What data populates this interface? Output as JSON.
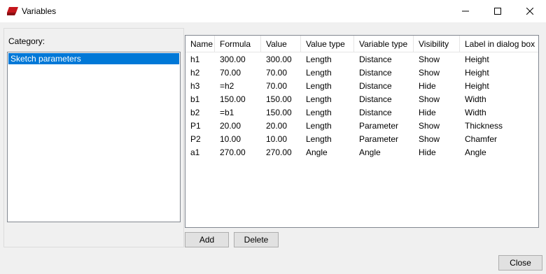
{
  "window": {
    "title": "Variables"
  },
  "category": {
    "label": "Category:",
    "items": [
      "Sketch parameters"
    ]
  },
  "table": {
    "columns": [
      "Name",
      "Formula",
      "Value",
      "Value type",
      "Variable type",
      "Visibility",
      "Label in dialog box"
    ],
    "rows": [
      [
        "h1",
        "300.00",
        "300.00",
        "Length",
        "Distance",
        "Show",
        "Height"
      ],
      [
        "h2",
        "70.00",
        "70.00",
        "Length",
        "Distance",
        "Show",
        "Height"
      ],
      [
        "h3",
        "=h2",
        "70.00",
        "Length",
        "Distance",
        "Hide",
        "Height"
      ],
      [
        "b1",
        "150.00",
        "150.00",
        "Length",
        "Distance",
        "Show",
        "Width"
      ],
      [
        "b2",
        "=b1",
        "150.00",
        "Length",
        "Distance",
        "Hide",
        "Width"
      ],
      [
        "P1",
        "20.00",
        "20.00",
        "Length",
        "Parameter",
        "Show",
        "Thickness"
      ],
      [
        "P2",
        "10.00",
        "10.00",
        "Length",
        "Parameter",
        "Show",
        "Chamfer"
      ],
      [
        "a1",
        "270.00",
        "270.00",
        "Angle",
        "Angle",
        "Hide",
        "Angle"
      ]
    ]
  },
  "buttons": {
    "add": "Add",
    "delete": "Delete",
    "close": "Close"
  },
  "colors": {
    "selection": "#0078d7",
    "button": "#e1e1e1",
    "icon": "#c4161c"
  }
}
